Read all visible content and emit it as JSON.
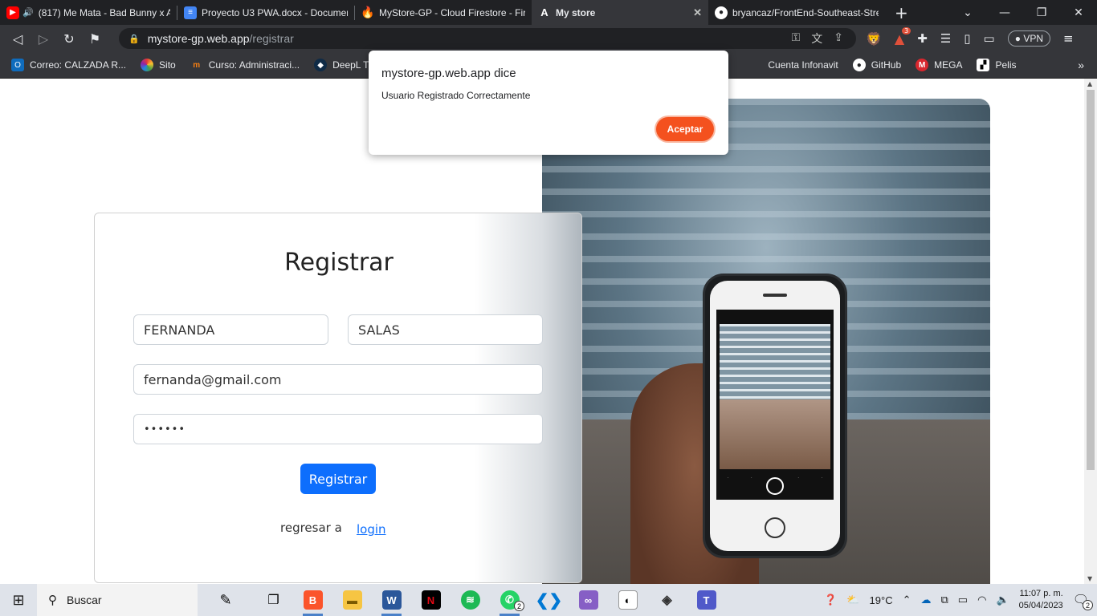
{
  "tabs": [
    {
      "title": "(817) Me Mata - Bad Bunny x A",
      "icon": "youtube-icon",
      "active": false
    },
    {
      "title": "Proyecto U3 PWA.docx - Documen",
      "icon": "google-docs-icon",
      "active": false
    },
    {
      "title": "MyStore-GP - Cloud Firestore - Fir",
      "icon": "firebase-icon",
      "active": false
    },
    {
      "title": "My store",
      "icon": "angular-icon",
      "active": true
    },
    {
      "title": "bryancaz/FrontEnd-Southeast-Stre",
      "icon": "github-icon",
      "active": false
    }
  ],
  "address": {
    "host": "mystore-gp.web.app",
    "path": "/registrar"
  },
  "vpn_label": "VPN",
  "brave_badge": "3",
  "bookmarks": [
    {
      "label": "Correo: CALZADA R...",
      "icon": "outlook-icon"
    },
    {
      "label": "Sito",
      "icon": "sito-icon"
    },
    {
      "label": "Curso: Administraci...",
      "icon": "moodle-icon"
    },
    {
      "label": "DeepL Tran",
      "icon": "deepl-icon"
    },
    {
      "label": "Cuenta Infonavit",
      "icon": "infonavit-icon"
    },
    {
      "label": "GitHub",
      "icon": "github-icon"
    },
    {
      "label": "MEGA",
      "icon": "mega-icon"
    },
    {
      "label": "Pelis",
      "icon": "clapper-icon"
    }
  ],
  "dialog": {
    "title": "mystore-gp.web.app dice",
    "message": "Usuario Registrado Correctamente",
    "button": "Aceptar"
  },
  "form": {
    "title": "Registrar",
    "first_name": "FERNANDA",
    "last_name": "SALAS",
    "email": "fernanda@gmail.com",
    "password_mask": "••••••",
    "submit": "Registrar",
    "back_text": "regresar a",
    "back_link": "login"
  },
  "taskbar": {
    "search_label": "Buscar",
    "weather": "19°C",
    "time": "11:07 p. m.",
    "date": "05/04/2023",
    "whatsapp_count": "2",
    "notif_count": "2"
  },
  "colors": {
    "primary": "#0d6efd",
    "dialog_button": "#f4511e",
    "browser_dark": "#202124",
    "toolbar": "#35363a"
  }
}
